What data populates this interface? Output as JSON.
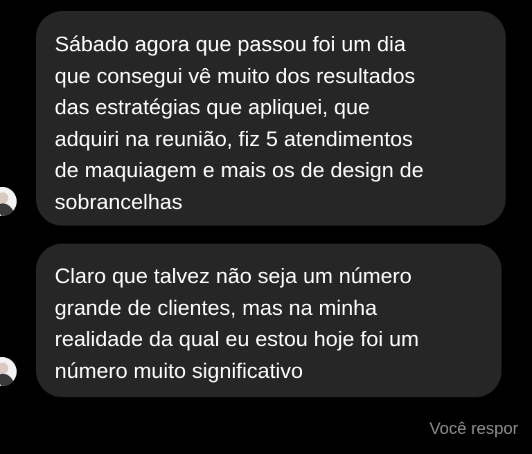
{
  "colors": {
    "background": "#000000",
    "bubble": "#262626",
    "message_text": "#ffffff",
    "footer_text": "#8e8e8e"
  },
  "messages": [
    {
      "avatar_icon": "user-avatar-icon",
      "lines": [
        "Sábado agora que passou foi um dia",
        "que consegui vê muito dos resultados",
        "das estratégias que apliquei, que",
        "adquiri na reunião, fiz 5 atendimentos",
        "de maquiagem e mais os de design de",
        "sobrancelhas"
      ]
    },
    {
      "avatar_icon": "user-avatar-icon",
      "lines": [
        "Claro que talvez não seja um número",
        "grande de clientes, mas na minha",
        "realidade da qual eu estou hoje foi um",
        "número muito significativo"
      ]
    }
  ],
  "footer": {
    "reply_status": "Você respor"
  }
}
